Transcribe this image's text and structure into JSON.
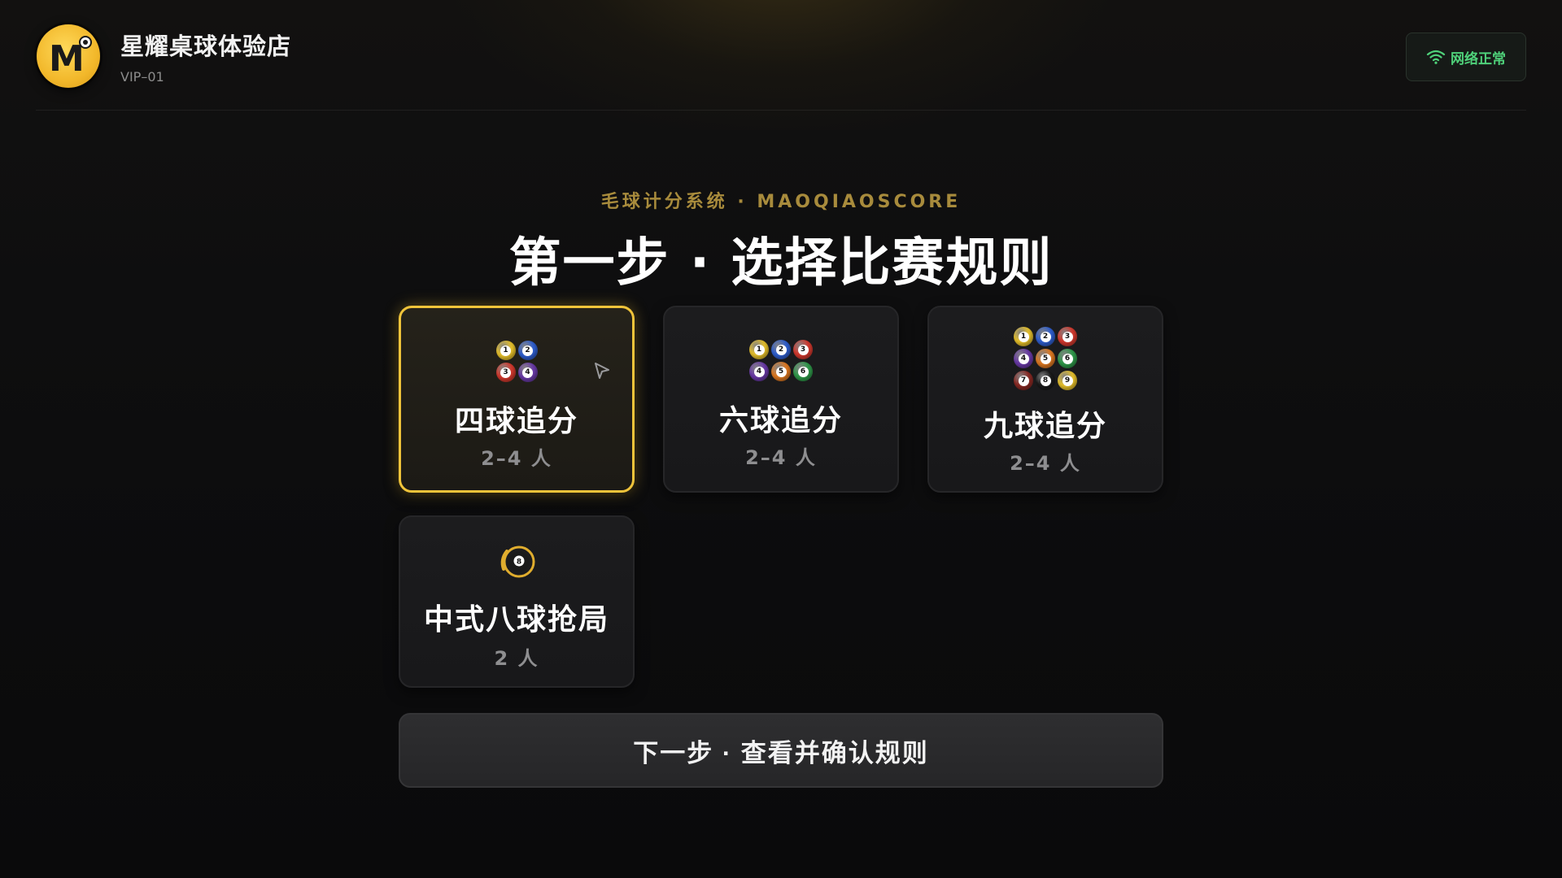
{
  "header": {
    "logo_letter": "M",
    "store_name": "星耀桌球体验店",
    "room_id": "VIP–01",
    "network_status": "网络正常",
    "network_icon": "wifi-icon",
    "network_color": "#4fd17a"
  },
  "main": {
    "subtitle": "毛球计分系统 · MAOQIAOSCORE",
    "title": "第一步 · 选择比赛规则",
    "rules": [
      {
        "title": "四球追分",
        "players": "2–4 人",
        "icon": "four-balls-icon",
        "selected": true
      },
      {
        "title": "六球追分",
        "players": "2–4 人",
        "icon": "six-balls-icon",
        "selected": false
      },
      {
        "title": "九球追分",
        "players": "2–4 人",
        "icon": "nine-balls-icon",
        "selected": false
      },
      {
        "title": "中式八球抢局",
        "players": "2 人",
        "icon": "eight-ball-icon",
        "selected": false
      }
    ],
    "next_button": "下一步 · 查看并确认规则"
  },
  "balls": {
    "1": {
      "label": "1",
      "color": "#e8c22c"
    },
    "2": {
      "label": "2",
      "color": "#2f5fd0"
    },
    "3": {
      "label": "3",
      "color": "#d4392e"
    },
    "4": {
      "label": "4",
      "color": "#6a3aa8"
    },
    "5": {
      "label": "5",
      "color": "#e07a22"
    },
    "6": {
      "label": "6",
      "color": "#2f9a4a"
    },
    "7": {
      "label": "7",
      "color": "#8a2a24"
    },
    "8": {
      "label": "8",
      "color": "#1a1a1a"
    },
    "9": {
      "label": "9",
      "color": "#e8c22c"
    }
  },
  "colors": {
    "accent": "#f0c43a",
    "subtitle": "#a88b3c"
  }
}
